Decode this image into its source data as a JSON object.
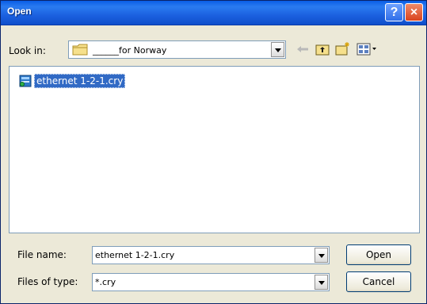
{
  "dialog": {
    "title": "Open",
    "help_label": "?",
    "close_label": "×"
  },
  "lookin": {
    "label": "Look in:",
    "value": "______for Norway"
  },
  "toolbar": {
    "back_icon": "back-arrow-icon",
    "up_icon": "up-folder-icon",
    "new_folder_icon": "new-folder-icon",
    "views_icon": "views-menu-icon"
  },
  "files": [
    {
      "name": "ethernet 1-2-1.cry",
      "selected": true,
      "icon": "crystal-report-file-icon"
    }
  ],
  "filename": {
    "label": "File name:",
    "value": "ethernet 1-2-1.cry"
  },
  "filetype": {
    "label": "Files of type:",
    "value": "*.cry"
  },
  "buttons": {
    "open": "Open",
    "cancel": "Cancel"
  },
  "colors": {
    "titlebar": "#1c61e0",
    "selection": "#316ac5",
    "close": "#d9431e"
  }
}
